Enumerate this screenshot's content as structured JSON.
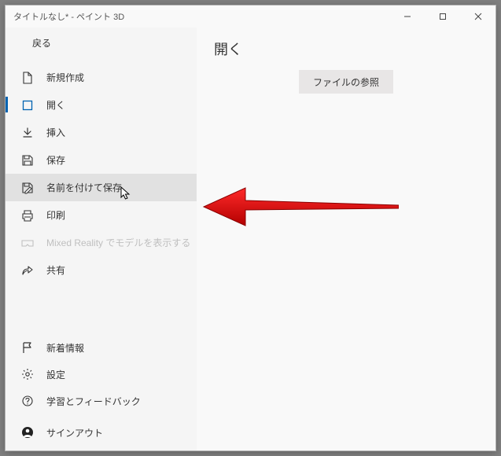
{
  "window": {
    "title": "タイトルなし* - ペイント 3D"
  },
  "caption": {
    "min": "—",
    "max": "▢",
    "close": "✕"
  },
  "back": {
    "label": "戻る"
  },
  "menu": {
    "new": {
      "label": "新規作成"
    },
    "open": {
      "label": "開く"
    },
    "insert": {
      "label": "挿入"
    },
    "save": {
      "label": "保存"
    },
    "saveas": {
      "label": "名前を付けて保存"
    },
    "print": {
      "label": "印刷"
    },
    "mr": {
      "label": "Mixed Reality でモデルを表示する"
    },
    "share": {
      "label": "共有"
    }
  },
  "bottom": {
    "news": {
      "label": "新着情報"
    },
    "settings": {
      "label": "設定"
    },
    "learn": {
      "label": "学習とフィードバック"
    },
    "signout": {
      "label": "サインアウト"
    }
  },
  "main": {
    "title": "開く",
    "browse": "ファイルの参照"
  }
}
